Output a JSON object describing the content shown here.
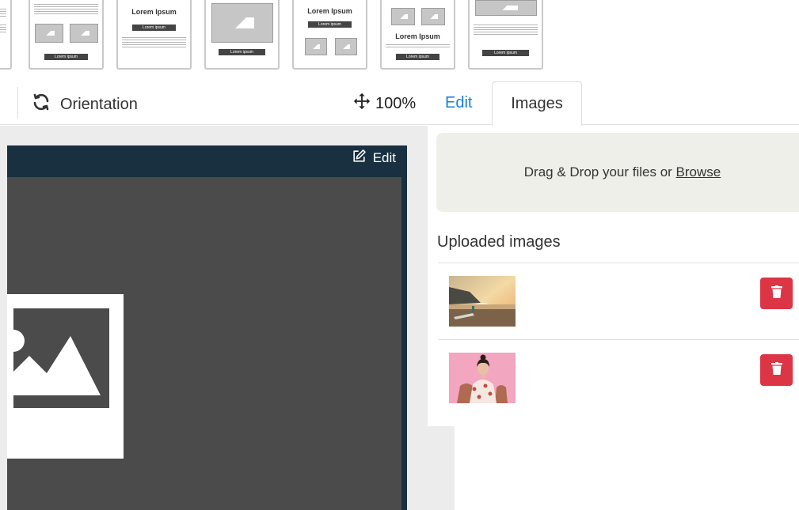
{
  "templates": [
    {
      "title": "",
      "button": "Lorem ipsum"
    },
    {
      "title": "Lorem Ipsum",
      "button": "Lorem ipsum"
    },
    {
      "title": "",
      "button": "Lorem ipsum"
    },
    {
      "title": "Lorem Ipsum",
      "button": "Lorem ipsum"
    },
    {
      "title": "Lorem Ipsum",
      "button": "Lorem ipsum"
    },
    {
      "title": "",
      "button": "Lorem ipsum"
    }
  ],
  "toolbar": {
    "orientation_label": "Orientation",
    "zoom_label": "100%"
  },
  "tabs": {
    "edit_label": "Edit",
    "images_label": "Images"
  },
  "canvas": {
    "edit_label": "Edit"
  },
  "panel": {
    "dropzone_text": "Drag & Drop your files or ",
    "browse_label": "Browse",
    "uploaded_title": "Uploaded images"
  },
  "icons": {
    "orientation": "refresh-icon",
    "zoom": "move-arrows-icon",
    "canvas_edit": "edit-square-icon",
    "placeholder": "image-icon",
    "delete": "trash-icon"
  },
  "colors": {
    "accent_link": "#1a7fdc",
    "delete_button": "#dc3545",
    "canvas_frame": "#18303f",
    "canvas_fill": "#4b4b4b",
    "dropzone_bg": "#efefea"
  }
}
